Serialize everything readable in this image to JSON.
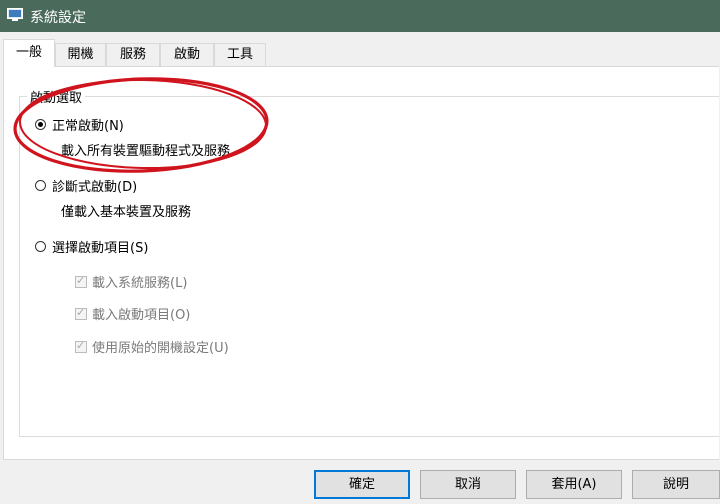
{
  "window": {
    "title": "系統設定",
    "icon": "system-config-icon"
  },
  "tabs": [
    {
      "label": "一般",
      "active": true
    },
    {
      "label": "開機",
      "active": false
    },
    {
      "label": "服務",
      "active": false
    },
    {
      "label": "啟動",
      "active": false
    },
    {
      "label": "工具",
      "active": false
    }
  ],
  "startup": {
    "group_label": "啟動選取",
    "normal": {
      "label": "正常啟動(N)",
      "desc": "載入所有裝置驅動程式及服務",
      "selected": true
    },
    "diagnostic": {
      "label": "診斷式啟動(D)",
      "desc": "僅載入基本裝置及服務",
      "selected": false
    },
    "selective": {
      "label": "選擇啟動項目(S)",
      "selected": false,
      "options": [
        {
          "label": "載入系統服務(L)",
          "checked": true,
          "disabled": true
        },
        {
          "label": "載入啟動項目(O)",
          "checked": true,
          "disabled": true
        },
        {
          "label": "使用原始的開機設定(U)",
          "checked": true,
          "disabled": true
        }
      ]
    }
  },
  "buttons": {
    "ok": "確定",
    "cancel": "取消",
    "apply": "套用(A)",
    "help": "說明"
  },
  "annotation": {
    "color": "#d0141e"
  }
}
